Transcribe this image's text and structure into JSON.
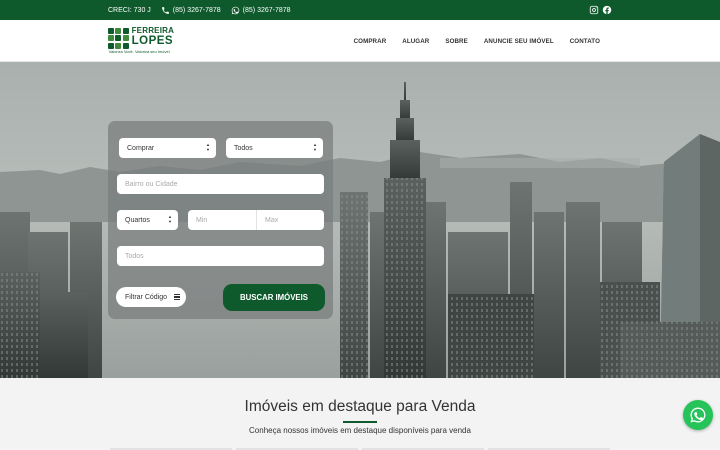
{
  "topbar": {
    "creci": "CRECI: 730 J",
    "phone": "(85) 3267-7878",
    "whatsapp": "(85) 3267-7878"
  },
  "logo": {
    "line1": "FERREIRA",
    "line2": "LOPES",
    "tagline": "Valoriza Você. Valoriza seu Imóvel"
  },
  "nav": [
    "COMPRAR",
    "ALUGAR",
    "SOBRE",
    "ANUNCIE SEU IMÓVEL",
    "CONTATO"
  ],
  "search": {
    "mode": "Comprar",
    "type": "Todos",
    "location_placeholder": "Bairro ou Cidade",
    "rooms": "Quartos",
    "min_placeholder": "Min",
    "max_placeholder": "Max",
    "todos_placeholder": "Todos",
    "filter_code": "Filtrar Código",
    "submit": "BUSCAR IMÓVEIS"
  },
  "featured": {
    "title": "Imóveis em destaque para Venda",
    "subtitle": "Conheça nossos imóveis em destaque disponíveis para venda"
  },
  "colors": {
    "brand_green": "#0e5a2c",
    "whatsapp_green": "#26c35a"
  },
  "icons": [
    "phone-icon",
    "whatsapp-icon",
    "instagram-icon",
    "facebook-icon",
    "menu-icon",
    "whatsapp-float-icon"
  ]
}
